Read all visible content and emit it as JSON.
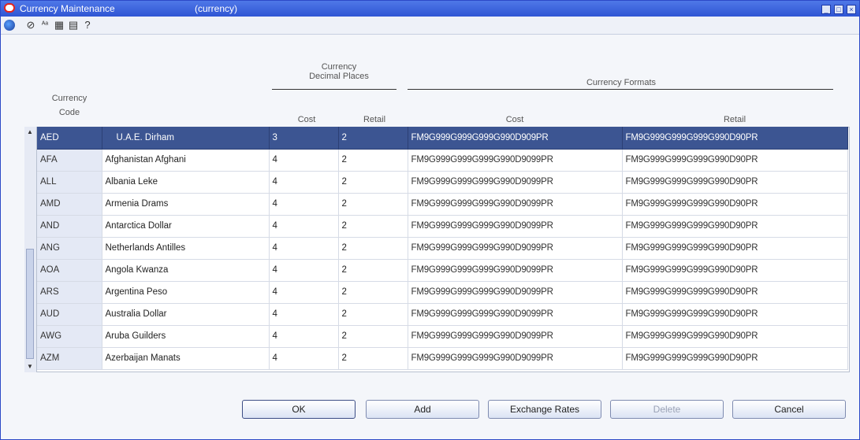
{
  "window": {
    "title": "Currency Maintenance",
    "subtitle": "(currency)"
  },
  "toolbar": {
    "icons": [
      "globe-icon",
      "help-icon",
      "spell-icon",
      "calendar-icon",
      "notes-icon",
      "question-icon"
    ]
  },
  "headers": {
    "currency_code_line1": "Currency",
    "currency_code_line2": "Code",
    "decimal_group_line1": "Currency",
    "decimal_group_line2": "Decimal Places",
    "formats_group": "Currency Formats",
    "cost": "Cost",
    "retail": "Retail",
    "fmt_cost": "Cost",
    "fmt_retail": "Retail"
  },
  "rows": [
    {
      "code": "AED",
      "name": "U.A.E. Dirham",
      "cost": "3",
      "retail": "2",
      "fmt_cost": "FM9G999G999G999G990D909PR",
      "fmt_retail": "FM9G999G999G999G990D90PR"
    },
    {
      "code": "AFA",
      "name": "Afghanistan Afghani",
      "cost": "4",
      "retail": "2",
      "fmt_cost": "FM9G999G999G999G990D9099PR",
      "fmt_retail": "FM9G999G999G999G990D90PR"
    },
    {
      "code": "ALL",
      "name": "Albania Leke",
      "cost": "4",
      "retail": "2",
      "fmt_cost": "FM9G999G999G999G990D9099PR",
      "fmt_retail": "FM9G999G999G999G990D90PR"
    },
    {
      "code": "AMD",
      "name": "Armenia Drams",
      "cost": "4",
      "retail": "2",
      "fmt_cost": "FM9G999G999G999G990D9099PR",
      "fmt_retail": "FM9G999G999G999G990D90PR"
    },
    {
      "code": "AND",
      "name": "Antarctica Dollar",
      "cost": "4",
      "retail": "2",
      "fmt_cost": "FM9G999G999G999G990D9099PR",
      "fmt_retail": "FM9G999G999G999G990D90PR"
    },
    {
      "code": "ANG",
      "name": "Netherlands Antilles",
      "cost": "4",
      "retail": "2",
      "fmt_cost": "FM9G999G999G999G990D9099PR",
      "fmt_retail": "FM9G999G999G999G990D90PR"
    },
    {
      "code": "AOA",
      "name": "Angola Kwanza",
      "cost": "4",
      "retail": "2",
      "fmt_cost": "FM9G999G999G999G990D9099PR",
      "fmt_retail": "FM9G999G999G999G990D90PR"
    },
    {
      "code": "ARS",
      "name": "Argentina Peso",
      "cost": "4",
      "retail": "2",
      "fmt_cost": "FM9G999G999G999G990D9099PR",
      "fmt_retail": "FM9G999G999G999G990D90PR"
    },
    {
      "code": "AUD",
      "name": "Australia Dollar",
      "cost": "4",
      "retail": "2",
      "fmt_cost": "FM9G999G999G999G990D9099PR",
      "fmt_retail": "FM9G999G999G999G990D90PR"
    },
    {
      "code": "AWG",
      "name": "Aruba Guilders",
      "cost": "4",
      "retail": "2",
      "fmt_cost": "FM9G999G999G999G990D9099PR",
      "fmt_retail": "FM9G999G999G999G990D90PR"
    },
    {
      "code": "AZM",
      "name": "Azerbaijan Manats",
      "cost": "4",
      "retail": "2",
      "fmt_cost": "FM9G999G999G999G990D9099PR",
      "fmt_retail": "FM9G999G999G999G990D90PR"
    }
  ],
  "selected_row": 0,
  "buttons": {
    "ok": "OK",
    "add": "Add",
    "exchange_rates": "Exchange Rates",
    "delete": "Delete",
    "cancel": "Cancel"
  }
}
